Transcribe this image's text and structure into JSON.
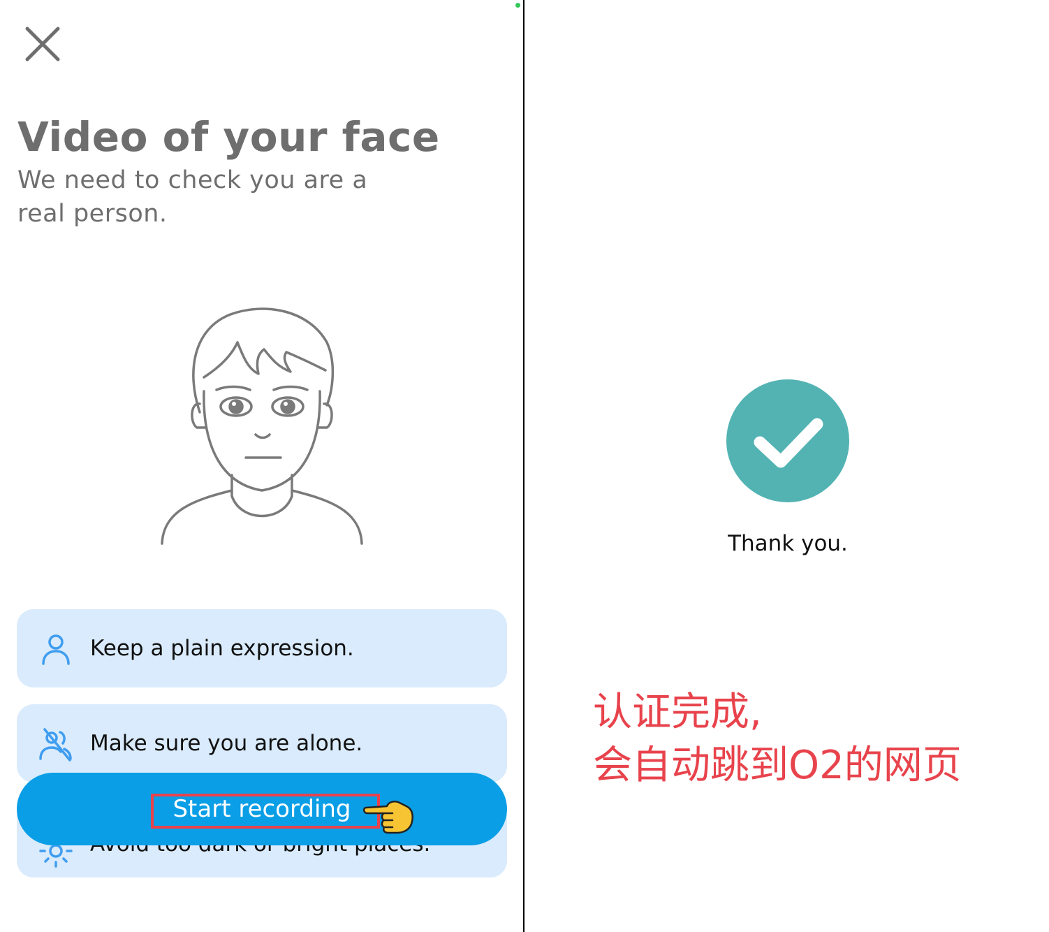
{
  "left_screen": {
    "close_icon": "close-icon",
    "title": "Video of your face",
    "subtitle": "We need to check you are a real person.",
    "illustration": "face-illustration",
    "tips": [
      {
        "icon": "person-icon",
        "label": "Keep a plain expression."
      },
      {
        "icon": "no-people-icon",
        "label": "Make sure you are alone."
      },
      {
        "icon": "light-icon",
        "label": "Avoid too dark or bright places."
      }
    ],
    "record_button": {
      "label": "Start recording"
    },
    "pointer_icon": "pointing-hand-icon"
  },
  "right_screen": {
    "status_icon": "checkmark-circle-icon",
    "message": "Thank you."
  },
  "annotation": {
    "line1": "认证完成,",
    "line2": "会自动跳到O2的网页"
  },
  "colors": {
    "tip_background": "#d9ebfc",
    "tip_icon": "#3f9df0",
    "button": "#0a9ee6",
    "check": "#53b3b3",
    "annotation": "#e8434c",
    "heading": "#6e6e6e"
  }
}
